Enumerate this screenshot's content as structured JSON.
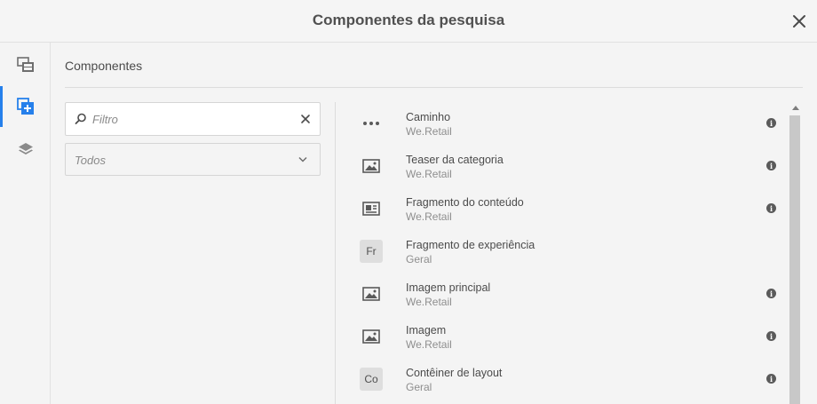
{
  "dialog": {
    "title": "Componentes da pesquisa"
  },
  "rail": {
    "items": [
      {
        "icon": "assets-icon",
        "active": false
      },
      {
        "icon": "add-component-icon",
        "active": true
      },
      {
        "icon": "layers-icon",
        "active": false
      }
    ]
  },
  "panel": {
    "heading": "Componentes",
    "filter": {
      "placeholder": "Filtro",
      "value": ""
    },
    "group_select": {
      "selected": "Todos"
    }
  },
  "components": [
    {
      "name": "Caminho",
      "group": "We.Retail",
      "icon": "ellipsis-icon",
      "info": true
    },
    {
      "name": "Teaser da categoria",
      "group": "We.Retail",
      "icon": "image-icon",
      "info": true
    },
    {
      "name": "Fragmento do conteúdo",
      "group": "We.Retail",
      "icon": "content-fragment-icon",
      "info": true
    },
    {
      "name": "Fragmento de experiência",
      "group": "Geral",
      "abbr": "Fr",
      "info": false
    },
    {
      "name": "Imagem principal",
      "group": "We.Retail",
      "icon": "image-icon",
      "info": true
    },
    {
      "name": "Imagem",
      "group": "We.Retail",
      "icon": "image-icon",
      "info": true
    },
    {
      "name": "Contêiner de layout",
      "group": "Geral",
      "abbr": "Co",
      "info": true
    }
  ],
  "colors": {
    "accent": "#2680eb",
    "background": "#f4f4f4",
    "text": "#4b4b4b",
    "muted_text": "#8e8e8e"
  }
}
